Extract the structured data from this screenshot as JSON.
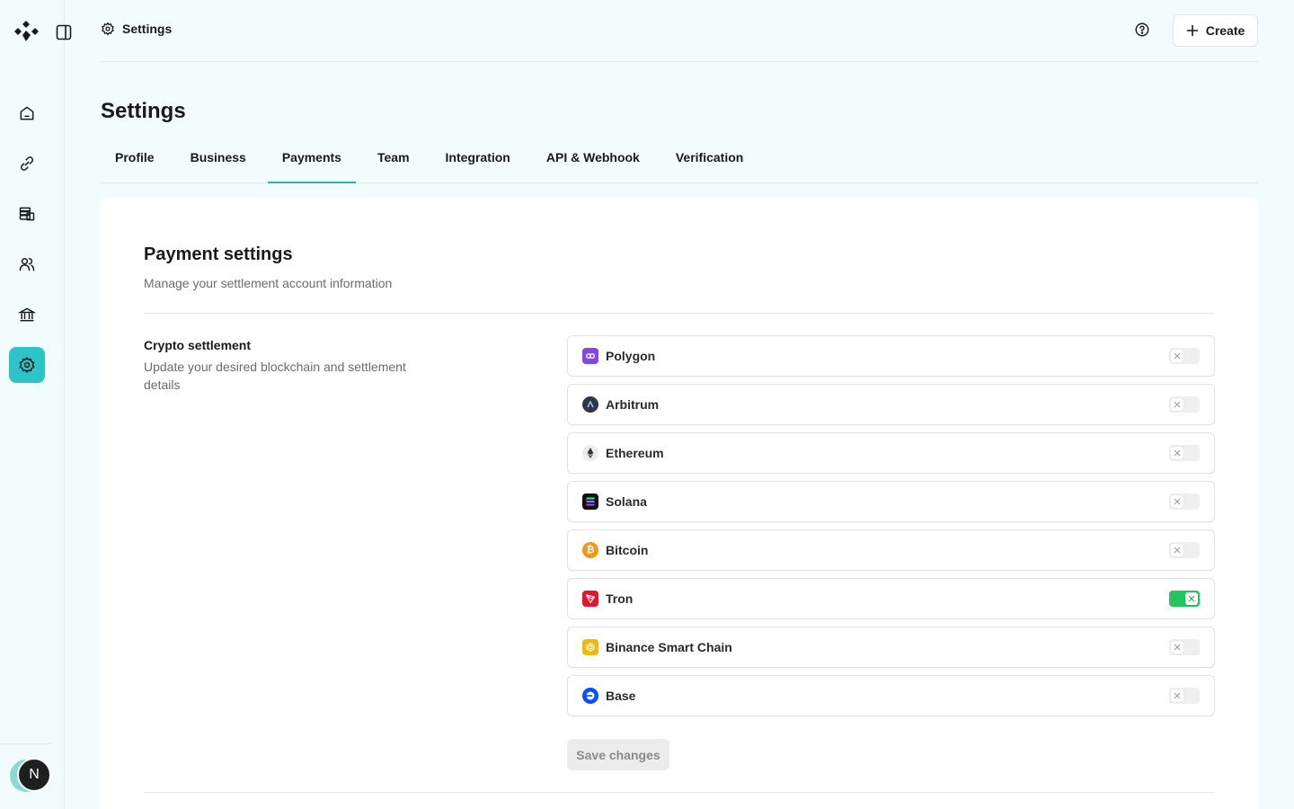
{
  "topbar": {
    "breadcrumb_label": "Settings",
    "create_label": "Create"
  },
  "page": {
    "title": "Settings"
  },
  "tabs": [
    {
      "label": "Profile",
      "active": false
    },
    {
      "label": "Business",
      "active": false
    },
    {
      "label": "Payments",
      "active": true
    },
    {
      "label": "Team",
      "active": false
    },
    {
      "label": "Integration",
      "active": false
    },
    {
      "label": "API & Webhook",
      "active": false
    },
    {
      "label": "Verification",
      "active": false
    }
  ],
  "payment_settings": {
    "title": "Payment settings",
    "description": "Manage your settlement account information",
    "crypto": {
      "title": "Crypto settlement",
      "description": "Update your desired blockchain and settlement details",
      "chains": [
        {
          "name": "Polygon",
          "icon": "polygon-icon",
          "color": "#8247e5",
          "enabled": false
        },
        {
          "name": "Arbitrum",
          "icon": "arbitrum-icon",
          "color": "#2d374b",
          "enabled": false
        },
        {
          "name": "Ethereum",
          "icon": "ethereum-icon",
          "color": "#e8e8e8",
          "enabled": false
        },
        {
          "name": "Solana",
          "icon": "solana-icon",
          "color": "#111111",
          "enabled": false
        },
        {
          "name": "Bitcoin",
          "icon": "bitcoin-icon",
          "color": "#f7931a",
          "enabled": false
        },
        {
          "name": "Tron",
          "icon": "tron-icon",
          "color": "#e5162b",
          "enabled": true
        },
        {
          "name": "Binance Smart Chain",
          "icon": "bnb-icon",
          "color": "#f0b90b",
          "enabled": false
        },
        {
          "name": "Base",
          "icon": "base-icon",
          "color": "#0052ff",
          "enabled": false
        }
      ]
    },
    "save_label": "Save changes"
  },
  "user": {
    "avatar_initial": "N"
  },
  "colors": {
    "accent": "#2cc4c6",
    "toggle_on": "#22c55e",
    "background": "#f2fcfc"
  }
}
